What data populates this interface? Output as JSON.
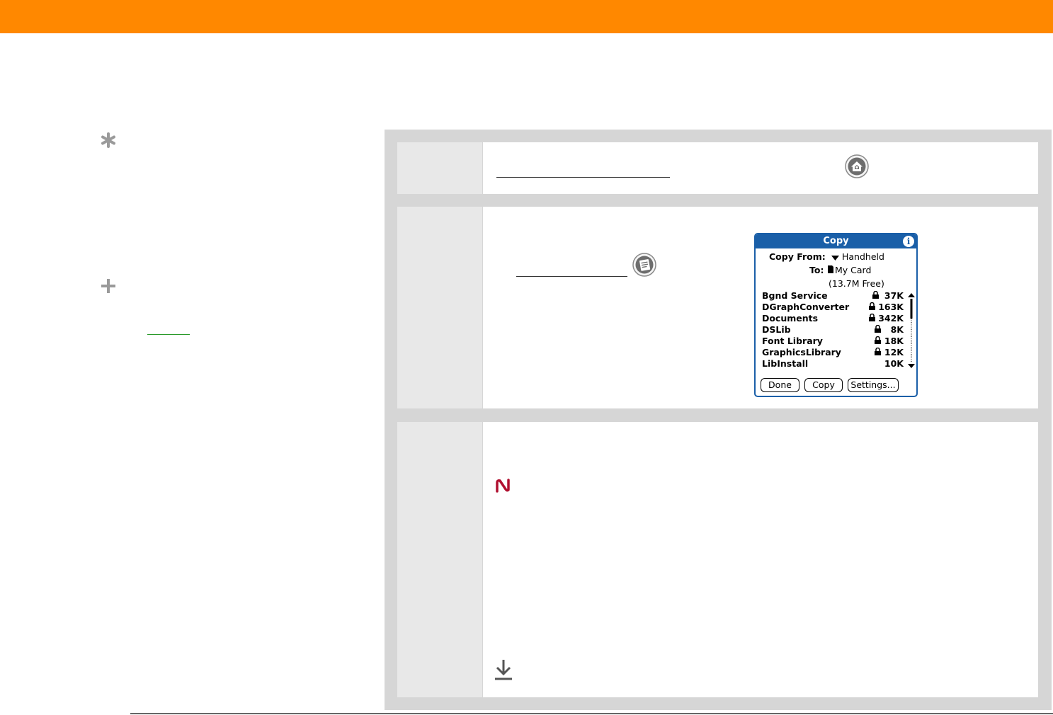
{
  "colors": {
    "header_bar": "#ff8800",
    "panel_gray": "#d6d6d6",
    "step_gray": "#e8e8e8",
    "palm_blue": "#1a5fa8",
    "warning_red": "#b01030",
    "link_green": "#2a9a2a"
  },
  "sidebar": {
    "tip_icon": "asterisk-icon",
    "more_icon": "plus-icon"
  },
  "steps": [
    {
      "icon": "home-icon"
    },
    {
      "icon": "menu-icon"
    },
    {
      "warning_icon": "palmos-warning-icon",
      "continue_icon": "down-arrow-icon"
    }
  ],
  "copy_dialog": {
    "title": "Copy",
    "info_glyph": "i",
    "copy_from_label": "Copy From:",
    "copy_from_value": "Handheld",
    "to_label": "To:",
    "to_value": "My Card",
    "free_space": "(13.7M Free)",
    "items": [
      {
        "name": "Bgnd Service",
        "size": "37K",
        "locked": true
      },
      {
        "name": "DGraphConverter",
        "size": "163K",
        "locked": true
      },
      {
        "name": "Documents",
        "size": "342K",
        "locked": true
      },
      {
        "name": "DSLib",
        "size": "8K",
        "locked": true
      },
      {
        "name": "Font Library",
        "size": "18K",
        "locked": true
      },
      {
        "name": "GraphicsLibrary",
        "size": "12K",
        "locked": true
      },
      {
        "name": "LibInstall",
        "size": "10K",
        "locked": false
      }
    ],
    "buttons": {
      "done": "Done",
      "copy": "Copy",
      "settings": "Settings..."
    }
  }
}
